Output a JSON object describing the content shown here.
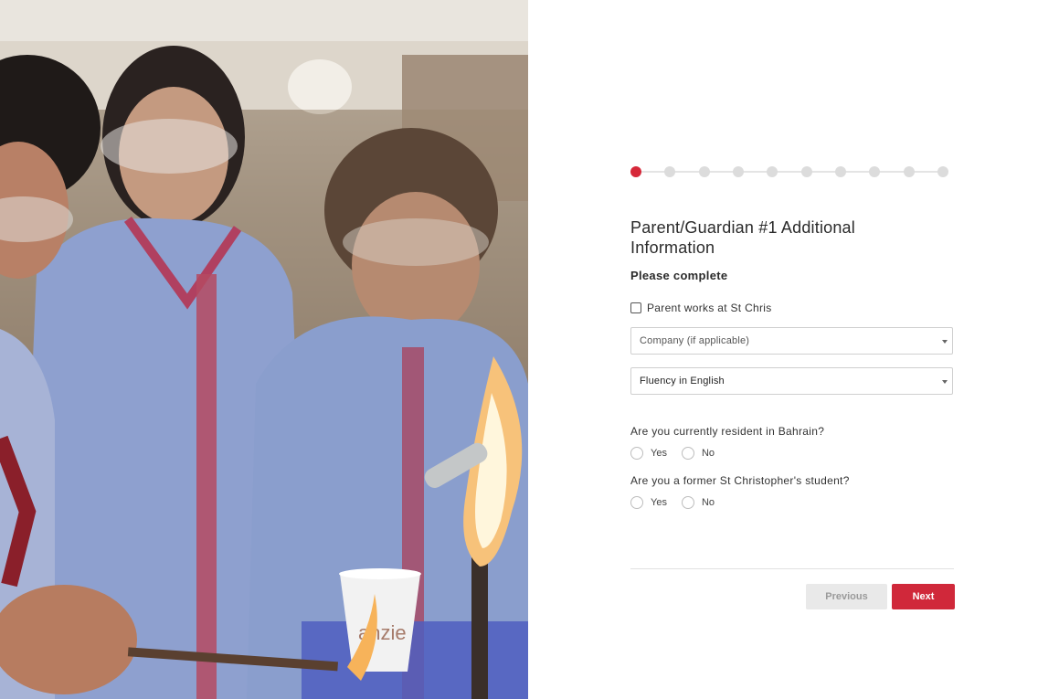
{
  "photo": {
    "description_icon": "students-science-lab-photo",
    "cup_text": "anzie"
  },
  "stepper": {
    "total_steps": 10,
    "current_step": 1,
    "active_color": "#d62839",
    "inactive_color": "#dcdcdc"
  },
  "form": {
    "title": "Parent/Guardian #1 Additional Information",
    "subtitle": "Please complete",
    "checkbox_label": "Parent works at St Chris",
    "checkbox_checked": false,
    "company_placeholder": "Company (if applicable)",
    "fluency_value": "Fluency in English",
    "question_resident": "Are you currently resident in Bahrain?",
    "question_former": "Are you a former St Christopher's student?",
    "yes_label": "Yes",
    "no_label": "No"
  },
  "buttons": {
    "previous": "Previous",
    "next": "Next",
    "next_color": "#d0283a"
  }
}
